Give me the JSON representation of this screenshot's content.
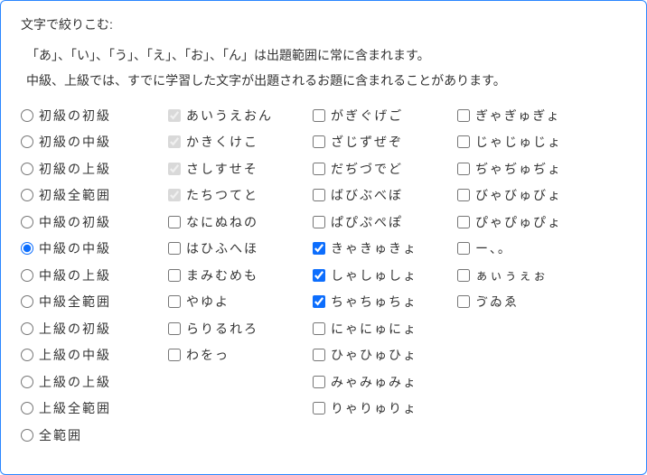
{
  "title": "文字で絞りこむ:",
  "note_line1": "「あ」、「い」、「う」、「え」、「お」、「ん」は出題範囲に常に含まれます。",
  "note_line2": "中級、上級では、すでに学習した文字が出題されるお題に含まれることがあります。",
  "levels": [
    {
      "label": "初級の初級",
      "selected": false
    },
    {
      "label": "初級の中級",
      "selected": false
    },
    {
      "label": "初級の上級",
      "selected": false
    },
    {
      "label": "初級全範囲",
      "selected": false
    },
    {
      "label": "中級の初級",
      "selected": false
    },
    {
      "label": "中級の中級",
      "selected": true
    },
    {
      "label": "中級の上級",
      "selected": false
    },
    {
      "label": "中級全範囲",
      "selected": false
    },
    {
      "label": "上級の初級",
      "selected": false
    },
    {
      "label": "上級の中級",
      "selected": false
    },
    {
      "label": "上級の上級",
      "selected": false
    },
    {
      "label": "上級全範囲",
      "selected": false
    },
    {
      "label": "全範囲",
      "selected": false
    }
  ],
  "col2": [
    {
      "label": "あいうえおん",
      "checked": true,
      "disabled": true
    },
    {
      "label": "かきくけこ",
      "checked": true,
      "disabled": true
    },
    {
      "label": "さしすせそ",
      "checked": true,
      "disabled": true
    },
    {
      "label": "たちつてと",
      "checked": true,
      "disabled": true
    },
    {
      "label": "なにぬねの",
      "checked": false,
      "disabled": false
    },
    {
      "label": "はひふへほ",
      "checked": false,
      "disabled": false
    },
    {
      "label": "まみむめも",
      "checked": false,
      "disabled": false
    },
    {
      "label": "やゆよ",
      "checked": false,
      "disabled": false
    },
    {
      "label": "らりるれろ",
      "checked": false,
      "disabled": false
    },
    {
      "label": "わをっ",
      "checked": false,
      "disabled": false
    }
  ],
  "col3": [
    {
      "label": "がぎぐげご",
      "checked": false,
      "disabled": false
    },
    {
      "label": "ざじずぜぞ",
      "checked": false,
      "disabled": false
    },
    {
      "label": "だぢづでど",
      "checked": false,
      "disabled": false
    },
    {
      "label": "ばびぶべぼ",
      "checked": false,
      "disabled": false
    },
    {
      "label": "ぱぴぷぺぽ",
      "checked": false,
      "disabled": false
    },
    {
      "label": "きゃきゅきょ",
      "checked": true,
      "disabled": false
    },
    {
      "label": "しゃしゅしょ",
      "checked": true,
      "disabled": false
    },
    {
      "label": "ちゃちゅちょ",
      "checked": true,
      "disabled": false
    },
    {
      "label": "にゃにゅにょ",
      "checked": false,
      "disabled": false
    },
    {
      "label": "ひゃひゅひょ",
      "checked": false,
      "disabled": false
    },
    {
      "label": "みゃみゅみょ",
      "checked": false,
      "disabled": false
    },
    {
      "label": "りゃりゅりょ",
      "checked": false,
      "disabled": false
    }
  ],
  "col4": [
    {
      "label": "ぎゃぎゅぎょ",
      "checked": false,
      "disabled": false
    },
    {
      "label": "じゃじゅじょ",
      "checked": false,
      "disabled": false
    },
    {
      "label": "ぢゃぢゅぢょ",
      "checked": false,
      "disabled": false
    },
    {
      "label": "びゃびゅびょ",
      "checked": false,
      "disabled": false
    },
    {
      "label": "ぴゃぴゅぴょ",
      "checked": false,
      "disabled": false
    },
    {
      "label": "ー、。",
      "checked": false,
      "disabled": false
    },
    {
      "label": "ぁぃぅぇぉ",
      "checked": false,
      "disabled": false
    },
    {
      "label": "ゔゐゑ",
      "checked": false,
      "disabled": false
    }
  ]
}
